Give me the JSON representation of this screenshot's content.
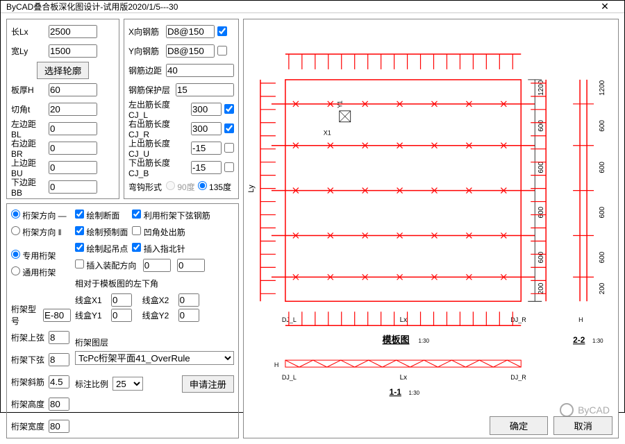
{
  "window": {
    "title": "ByCAD叠合板深化图设计-试用版2020/1/5---30"
  },
  "dims": {
    "lx_label": "长Lx",
    "lx": "2500",
    "ly_label": "宽Ly",
    "ly": "1500",
    "select_outline": "选择轮廓",
    "h_label": "板厚H",
    "h": "60",
    "t_label": "切角t",
    "t": "20",
    "bl_label": "左边距BL",
    "bl": "0",
    "br_label": "右边距BR",
    "br": "0",
    "bu_label": "上边距BU",
    "bu": "0",
    "bb_label": "下边距BB",
    "bb": "0"
  },
  "rebar": {
    "x_label": "X向钢筋",
    "x": "D8@150",
    "y_label": "Y向钢筋",
    "y": "D8@150",
    "edge_label": "钢筋边距",
    "edge": "40",
    "cover_label": "钢筋保护层",
    "cover": "15",
    "cjl_label": "左出筋长度CJ_L",
    "cjl": "300",
    "cjr_label": "右出筋长度CJ_R",
    "cjr": "300",
    "cju_label": "上出筋长度CJ_U",
    "cju": "-15",
    "cjb_label": "下出筋长度CJ_B",
    "cjb": "-15",
    "hook_label": "弯钩形式",
    "hook90": "90度",
    "hook135": "135度"
  },
  "truss": {
    "dir1": "桁架方向 —",
    "dir2": "桁架方向 ‖",
    "dedicated": "专用桁架",
    "general": "通用桁架",
    "model_label": "桁架型号",
    "model": "E-80",
    "top_label": "桁架上弦",
    "top": "8",
    "bot_label": "桁架下弦",
    "bot": "8",
    "diag_label": "桁架斜筋",
    "diag": "4.5",
    "height_label": "桁架高度",
    "height": "80",
    "width_label": "桁架宽度",
    "width": "80"
  },
  "opts": {
    "draw_section": "绘制断面",
    "use_truss_bottom": "利用桁架下弦钢筋",
    "draw_precast": "绘制预制面",
    "corner_rebar": "凹角处出筋",
    "draw_lift": "绘制起吊点",
    "insert_compass": "插入指北针",
    "insert_assembly": "插入装配方向",
    "a1": "0",
    "a2": "0",
    "corner_note": "相对于模板图的左下角",
    "box_x1_label": "线盒X1",
    "box_x1": "0",
    "box_x2_label": "线盒X2",
    "box_x2": "0",
    "box_y1_label": "线盒Y1",
    "box_y1": "0",
    "box_y2_label": "线盒Y2",
    "box_y2": "0",
    "layer_label": "桁架图层",
    "layer": "TcPc桁架平面41_OverRule",
    "scale_label": "标注比例",
    "scale": "25",
    "register": "申请注册"
  },
  "preview": {
    "plan_title": "模板图",
    "plan_scale": "1:30",
    "sec11": "1-1",
    "sec11_scale": "1:30",
    "sec22": "2-2",
    "sec22_scale": "1:30",
    "lx": "Lx",
    "ly": "Ly",
    "djl": "DJ_L",
    "djr": "DJ_R",
    "h": "H",
    "d1200": "1200",
    "d600": "600",
    "d200": "200",
    "x1": "X1",
    "y1": "Y1"
  },
  "buttons": {
    "ok": "确定",
    "cancel": "取消"
  },
  "watermark": "ByCAD"
}
